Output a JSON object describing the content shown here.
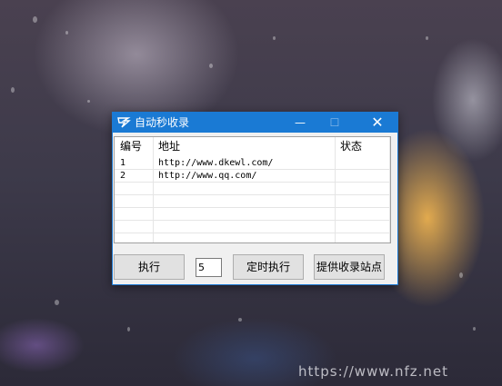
{
  "window": {
    "title": "自动秒收录",
    "minimize_glyph": "—",
    "maximize_glyph": "☐",
    "close_glyph": "✕"
  },
  "table": {
    "columns": [
      "编号",
      "地址",
      "状态"
    ],
    "rows": [
      {
        "index": "1",
        "url": "http://www.dkewl.com/",
        "status": ""
      },
      {
        "index": "2",
        "url": "http://www.qq.com/",
        "status": ""
      }
    ]
  },
  "controls": {
    "execute_label": "执行",
    "interval_value": "5",
    "scheduled_label": "定时执行",
    "submit_sites_label": "提供收录站点"
  },
  "watermark": "https://www.nfz.net",
  "icons": {
    "app": "app-icon",
    "minimize": "minimize-icon",
    "maximize": "maximize-icon",
    "close": "close-icon"
  },
  "colors": {
    "titlebar": "#1a7ad4",
    "window_bg": "#f0f0f0",
    "button_bg": "#e1e1e1"
  }
}
